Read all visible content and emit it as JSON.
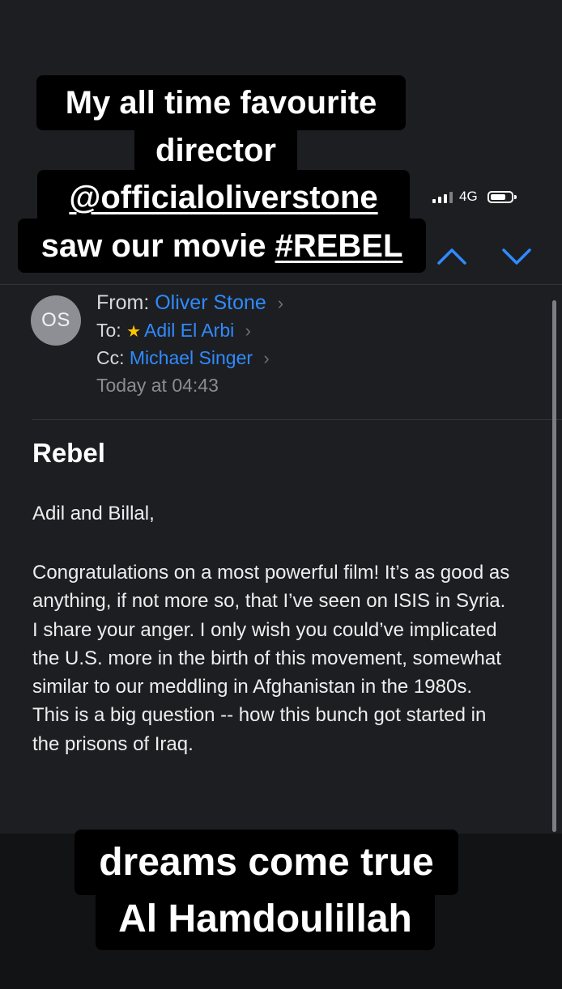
{
  "status_bar": {
    "network": "4G"
  },
  "navigation": {
    "previous_icon": "chevron-up-icon",
    "next_icon": "chevron-down-icon"
  },
  "email": {
    "avatar_initials": "OS",
    "from_label": "From:",
    "from_name": "Oliver Stone",
    "to_label": "To:",
    "to_name": "Adil El Arbi",
    "cc_label": "Cc:",
    "cc_name": "Michael Singer",
    "date": "Today at 04:43",
    "subject": "Rebel",
    "greeting": "Adil and Billal,",
    "body": "Congratulations on a most powerful film! It’s as good as anything, if not more so, that I’ve seen on ISIS in Syria. I share your anger. I only wish you could’ve implicated the U.S. more in the birth of this movement, somewhat similar to our meddling in Afghanistan in the 1980s. This is a big question -- how this bunch got started in the prisons of Iraq."
  },
  "story_text": {
    "line1": "My all time favourite",
    "line2": "director",
    "line3": "@officialoliverstone",
    "line4_prefix": "saw our movie ",
    "line4_hashtag": "#REBEL",
    "bottom_line1": "dreams come true",
    "bottom_line2": "Al Hamdoulillah"
  },
  "icons": {
    "signal": "signal-icon",
    "battery": "battery-icon",
    "favorite": "star-icon",
    "chevron": "chevron-right-icon"
  },
  "colors": {
    "accent": "#2f8bff",
    "star": "#ffc400"
  }
}
